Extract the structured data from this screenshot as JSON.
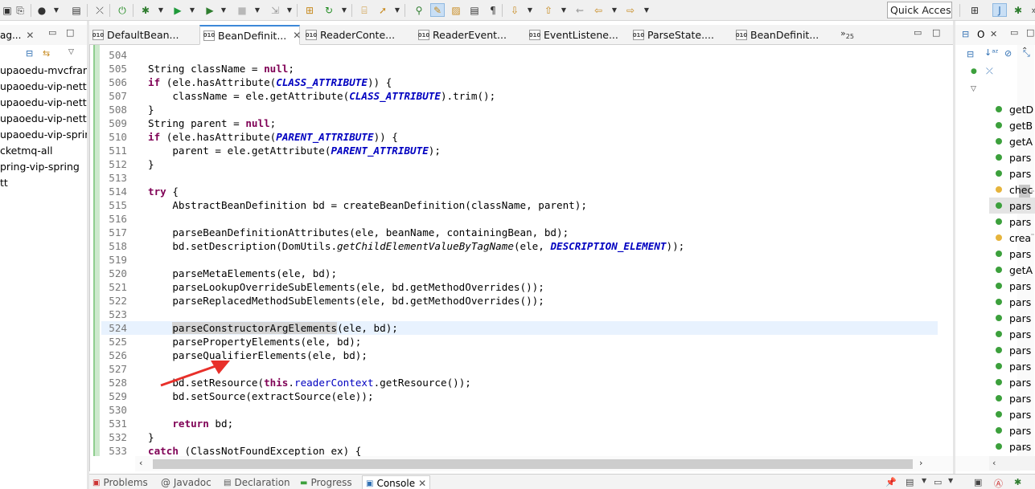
{
  "toolbar": {
    "quick_access": "Quick Access",
    "icons": [
      "save-all-icon",
      "print-icon",
      "profile-icon",
      "open-console-icon",
      "skip-breakpoints-icon",
      "spring-boot-icon",
      "debug-icon",
      "run-icon",
      "run-external-tool-icon",
      "stop-icon",
      "step-into-icon",
      "new-package-icon",
      "refresh-icon",
      "open-type-icon",
      "open-task-icon",
      "search-icon",
      "toggle-mark-occurrences-icon",
      "toggle-block-selection-icon",
      "show-whitespace-icon",
      "paragraph-icon",
      "next-annotation-icon",
      "previous-annotation-icon",
      "last-edit-location-icon",
      "back-icon",
      "forward-icon",
      "perspective-icon",
      "java-perspective-icon",
      "debug-perspective-icon"
    ]
  },
  "left_panel": {
    "tab_label": "ag...",
    "items": [
      "upaoedu-mvcfram",
      "upaoedu-vip-netty",
      "upaoedu-vip-netty",
      "upaoedu-vip-netty",
      "upaoedu-vip-sprin",
      "cketmq-all",
      "pring-vip-spring",
      "tt"
    ]
  },
  "editor_tabs": [
    {
      "label": "DefaultBean...",
      "active": false
    },
    {
      "label": "BeanDefinit...",
      "active": true
    },
    {
      "label": "ReaderConte...",
      "active": false
    },
    {
      "label": "ReaderEvent...",
      "active": false
    },
    {
      "label": "EventListene...",
      "active": false
    },
    {
      "label": "ParseState....",
      "active": false
    },
    {
      "label": "BeanDefinit...",
      "active": false
    }
  ],
  "more_tabs_count": "25",
  "editor": {
    "current_line": "524",
    "lines": [
      {
        "n": "504",
        "code": ""
      },
      {
        "n": "505",
        "code": "String className = null;"
      },
      {
        "n": "506",
        "code": "if (ele.hasAttribute(CLASS_ATTRIBUTE)) {"
      },
      {
        "n": "507",
        "code": "    className = ele.getAttribute(CLASS_ATTRIBUTE).trim();"
      },
      {
        "n": "508",
        "code": "}"
      },
      {
        "n": "509",
        "code": "String parent = null;"
      },
      {
        "n": "510",
        "code": "if (ele.hasAttribute(PARENT_ATTRIBUTE)) {"
      },
      {
        "n": "511",
        "code": "    parent = ele.getAttribute(PARENT_ATTRIBUTE);"
      },
      {
        "n": "512",
        "code": "}"
      },
      {
        "n": "513",
        "code": ""
      },
      {
        "n": "514",
        "code": "try {"
      },
      {
        "n": "515",
        "code": "    AbstractBeanDefinition bd = createBeanDefinition(className, parent);"
      },
      {
        "n": "516",
        "code": ""
      },
      {
        "n": "517",
        "code": "    parseBeanDefinitionAttributes(ele, beanName, containingBean, bd);"
      },
      {
        "n": "518",
        "code": "    bd.setDescription(DomUtils.getChildElementValueByTagName(ele, DESCRIPTION_ELEMENT));"
      },
      {
        "n": "519",
        "code": ""
      },
      {
        "n": "520",
        "code": "    parseMetaElements(ele, bd);"
      },
      {
        "n": "521",
        "code": "    parseLookupOverrideSubElements(ele, bd.getMethodOverrides());"
      },
      {
        "n": "522",
        "code": "    parseReplacedMethodSubElements(ele, bd.getMethodOverrides());"
      },
      {
        "n": "523",
        "code": ""
      },
      {
        "n": "524",
        "code": "    parseConstructorArgElements(ele, bd);"
      },
      {
        "n": "525",
        "code": "    parsePropertyElements(ele, bd);"
      },
      {
        "n": "526",
        "code": "    parseQualifierElements(ele, bd);"
      },
      {
        "n": "527",
        "code": ""
      },
      {
        "n": "528",
        "code": "    bd.setResource(this.readerContext.getResource());"
      },
      {
        "n": "529",
        "code": "    bd.setSource(extractSource(ele));"
      },
      {
        "n": "530",
        "code": ""
      },
      {
        "n": "531",
        "code": "    return bd;"
      },
      {
        "n": "532",
        "code": "}"
      },
      {
        "n": "533",
        "code": "catch (ClassNotFoundException ex) {"
      }
    ]
  },
  "outline": {
    "tab_label": "O",
    "items": [
      {
        "label": "getD",
        "color": "#3ca03c"
      },
      {
        "label": "getB",
        "color": "#3ca03c"
      },
      {
        "label": "getA",
        "color": "#3ca03c"
      },
      {
        "label": "pars",
        "color": "#3ca03c"
      },
      {
        "label": "pars",
        "color": "#3ca03c"
      },
      {
        "label": "chec",
        "color": "#e6b43c"
      },
      {
        "label": "pars",
        "color": "#3ca03c",
        "selected": true
      },
      {
        "label": "pars",
        "color": "#3ca03c"
      },
      {
        "label": "crea",
        "color": "#e6b43c"
      },
      {
        "label": "pars",
        "color": "#3ca03c"
      },
      {
        "label": "getA",
        "color": "#3ca03c"
      },
      {
        "label": "pars",
        "color": "#3ca03c"
      },
      {
        "label": "pars",
        "color": "#3ca03c"
      },
      {
        "label": "pars",
        "color": "#3ca03c"
      },
      {
        "label": "pars",
        "color": "#3ca03c"
      },
      {
        "label": "pars",
        "color": "#3ca03c"
      },
      {
        "label": "pars",
        "color": "#3ca03c"
      },
      {
        "label": "pars",
        "color": "#3ca03c"
      },
      {
        "label": "pars",
        "color": "#3ca03c"
      },
      {
        "label": "pars",
        "color": "#3ca03c"
      },
      {
        "label": "pars",
        "color": "#3ca03c"
      },
      {
        "label": "pars",
        "color": "#3ca03c"
      }
    ]
  },
  "bottom_tabs": [
    {
      "label": "Problems",
      "active": false
    },
    {
      "label": "@ Javadoc",
      "active": false
    },
    {
      "label": "Declaration",
      "active": false
    },
    {
      "label": "Progress",
      "active": false
    },
    {
      "label": "Console",
      "active": true
    }
  ],
  "colors": {
    "keyword": "#7f0055",
    "constant": "#0000c0",
    "current_line": "#e8f2fe",
    "annotation_arrow": "#e8302a"
  }
}
